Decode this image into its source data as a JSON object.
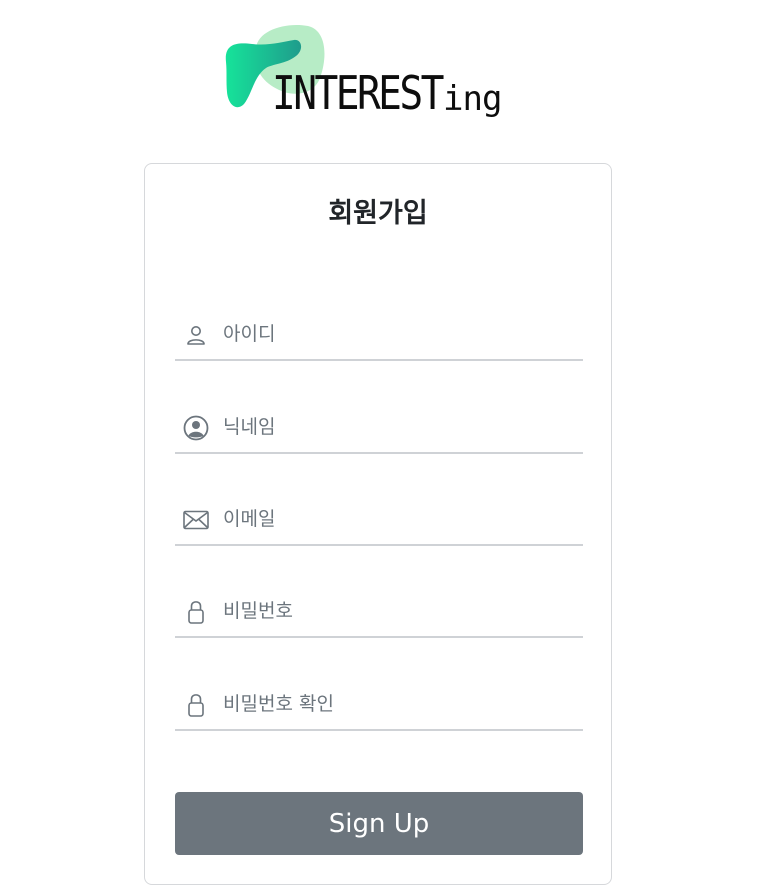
{
  "logo": {
    "caps_text": "INTEREST",
    "small_text": "ing",
    "gradient_start": "#16e39a",
    "gradient_end": "#1e8f8a",
    "blob_color": "#b7ecc6"
  },
  "signup_form": {
    "title": "회원가입",
    "fields": [
      {
        "icon": "person-outline-icon",
        "placeholder": "아이디",
        "type": "text"
      },
      {
        "icon": "person-circle-icon",
        "placeholder": "닉네임",
        "type": "text"
      },
      {
        "icon": "envelope-icon",
        "placeholder": "이메일",
        "type": "email"
      },
      {
        "icon": "lock-icon",
        "placeholder": "비밀번호",
        "type": "password"
      },
      {
        "icon": "lock-icon",
        "placeholder": "비밀번호 확인",
        "type": "password"
      }
    ],
    "submit_label": "Sign Up"
  },
  "colors": {
    "button_bg": "#6c757d",
    "button_text": "#ffffff",
    "underline": "#cfd2d6",
    "placeholder": "#6c757d",
    "icon": "#6c757d",
    "card_border": "#d6d8db"
  }
}
